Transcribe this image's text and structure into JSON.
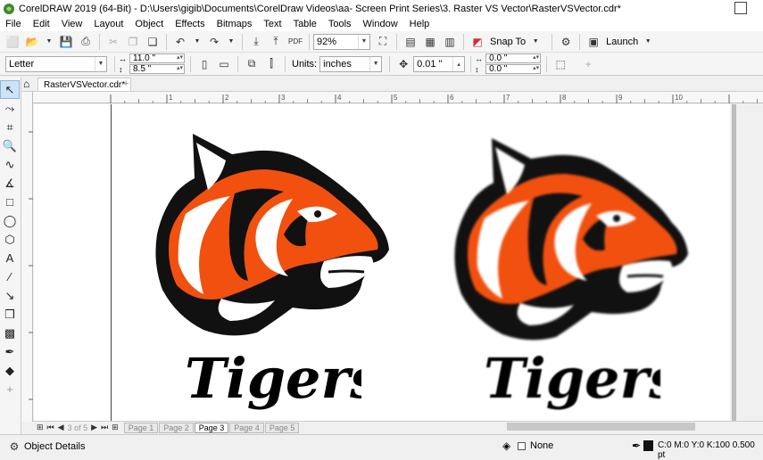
{
  "titlebar": {
    "title": "CorelDRAW 2019 (64-Bit) - D:\\Users\\gigib\\Documents\\CorelDraw Videos\\aa- Screen Print Series\\3. Raster VS Vector\\RasterVSVector.cdr*"
  },
  "menu": [
    "File",
    "Edit",
    "View",
    "Layout",
    "Object",
    "Effects",
    "Bitmaps",
    "Text",
    "Table",
    "Tools",
    "Window",
    "Help"
  ],
  "toolbar1": {
    "zoom": "92%",
    "snap_to": "Snap To",
    "launch": "Launch"
  },
  "toolbar2": {
    "page_size": "Letter",
    "width": "11.0 \"",
    "height": "8.5 \"",
    "units_label": "Units:",
    "units": "inches",
    "nudge": "0.01 \"",
    "dup_x": "0.0 \"",
    "dup_y": "0.0 \""
  },
  "document_tab": "RasterVSVector.cdr*",
  "canvas": {
    "left_art_text": "Tigers",
    "right_art_text": "Tigers",
    "colors": {
      "orange": "#f2500f",
      "black": "#111111",
      "white": "#ffffff"
    }
  },
  "pagebar": {
    "page_counter": "3  of  5",
    "pages": [
      "Page 1",
      "Page 2",
      "Page 3",
      "Page 4",
      "Page 5"
    ],
    "active_page": "Page 3"
  },
  "statusbar": {
    "object_details": "Object Details",
    "fill": "None",
    "outline": "C:0 M:0 Y:0 K:100  0.500 pt"
  },
  "ruler_labels": [
    "1",
    "2",
    "3",
    "4",
    "5",
    "6",
    "7",
    "8",
    "9",
    "10"
  ]
}
